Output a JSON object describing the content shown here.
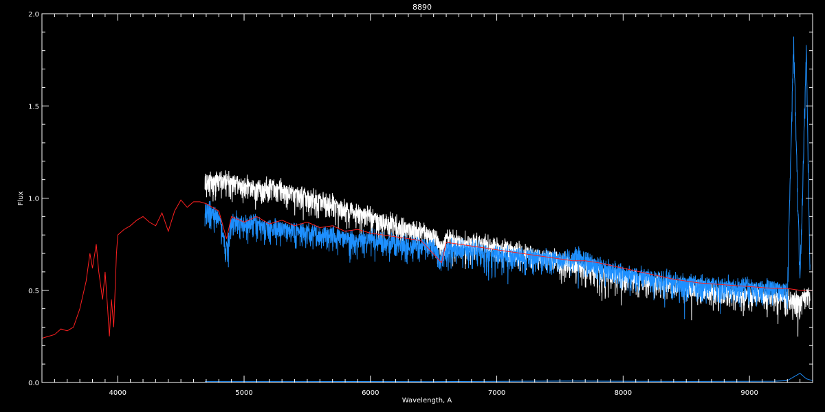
{
  "chart_data": {
    "type": "line",
    "title": "8890",
    "xlabel": "Wavelength, A",
    "ylabel": "Flux",
    "xlim": [
      3400,
      9500
    ],
    "ylim": [
      0.0,
      2.0
    ],
    "x_ticks": [
      4000,
      5000,
      6000,
      7000,
      8000,
      9000
    ],
    "y_ticks": [
      0.0,
      0.5,
      1.0,
      1.5,
      2.0
    ],
    "y_tick_labels": [
      "0.0",
      "0.5",
      "1.0",
      "1.5",
      "2.0"
    ],
    "grid": false,
    "background": "#000000",
    "series": [
      {
        "color": "#ffffff",
        "style": "noisy",
        "x": [
          4690,
          4750,
          4800,
          4900,
          5000,
          5100,
          5200,
          5300,
          5400,
          5500,
          5600,
          5700,
          5800,
          5900,
          6000,
          6100,
          6200,
          6300,
          6400,
          6500,
          6560,
          6600,
          6700,
          6800,
          6900,
          7000,
          7200,
          7400,
          7600,
          7700,
          7800,
          8000,
          8200,
          8400,
          8600,
          8800,
          9000,
          9200,
          9300,
          9400,
          9480
        ],
        "y": [
          1.1,
          1.09,
          1.1,
          1.09,
          1.07,
          1.05,
          1.06,
          1.05,
          1.03,
          1.01,
          0.99,
          0.97,
          0.94,
          0.92,
          0.9,
          0.88,
          0.86,
          0.84,
          0.82,
          0.8,
          0.74,
          0.78,
          0.77,
          0.76,
          0.75,
          0.74,
          0.71,
          0.68,
          0.64,
          0.62,
          0.6,
          0.58,
          0.56,
          0.53,
          0.51,
          0.49,
          0.48,
          0.47,
          0.46,
          0.45,
          0.48
        ]
      },
      {
        "color": "#1e90ff",
        "style": "noisy",
        "x": [
          4690,
          4750,
          4800,
          4860,
          4900,
          5000,
          5100,
          5200,
          5300,
          5400,
          5500,
          5600,
          5700,
          5800,
          5900,
          6000,
          6100,
          6200,
          6300,
          6400,
          6500,
          6563,
          6600,
          6700,
          6800,
          6900,
          7000,
          7200,
          7400,
          7600,
          7620,
          7700,
          7800,
          8000,
          8200,
          8400,
          8600,
          8800,
          9000,
          9200,
          9300,
          9350,
          9400,
          9450,
          9480
        ],
        "y": [
          0.95,
          0.93,
          0.9,
          0.72,
          0.88,
          0.87,
          0.86,
          0.85,
          0.84,
          0.83,
          0.82,
          0.81,
          0.8,
          0.79,
          0.78,
          0.78,
          0.77,
          0.76,
          0.75,
          0.75,
          0.74,
          0.65,
          0.73,
          0.72,
          0.72,
          0.71,
          0.7,
          0.69,
          0.68,
          0.67,
          0.7,
          0.66,
          0.64,
          0.6,
          0.57,
          0.55,
          0.54,
          0.53,
          0.52,
          0.52,
          0.5,
          1.85,
          0.55,
          1.8,
          0.58
        ]
      },
      {
        "color": "#ff2020",
        "style": "line",
        "x": [
          3400,
          3450,
          3500,
          3550,
          3600,
          3650,
          3700,
          3750,
          3780,
          3800,
          3830,
          3850,
          3880,
          3900,
          3920,
          3934,
          3950,
          3968,
          3990,
          4000,
          4050,
          4100,
          4150,
          4200,
          4250,
          4300,
          4350,
          4400,
          4450,
          4500,
          4550,
          4600,
          4650,
          4700,
          4750,
          4800,
          4861,
          4900,
          5000,
          5100,
          5200,
          5300,
          5400,
          5500,
          5600,
          5700,
          5800,
          5900,
          6000,
          6200,
          6400,
          6563,
          6600,
          6800,
          7000,
          7200,
          7400,
          7600,
          7700,
          7800,
          8000,
          8200,
          8400,
          8600,
          8800,
          9000,
          9200,
          9300,
          9400,
          9500
        ],
        "y": [
          0.24,
          0.25,
          0.26,
          0.29,
          0.28,
          0.3,
          0.4,
          0.55,
          0.7,
          0.62,
          0.75,
          0.6,
          0.45,
          0.6,
          0.4,
          0.25,
          0.45,
          0.3,
          0.7,
          0.8,
          0.83,
          0.85,
          0.88,
          0.9,
          0.87,
          0.85,
          0.92,
          0.82,
          0.93,
          0.99,
          0.95,
          0.98,
          0.98,
          0.97,
          0.95,
          0.93,
          0.78,
          0.9,
          0.87,
          0.9,
          0.86,
          0.88,
          0.85,
          0.87,
          0.84,
          0.85,
          0.82,
          0.83,
          0.81,
          0.79,
          0.77,
          0.65,
          0.76,
          0.74,
          0.72,
          0.7,
          0.68,
          0.66,
          0.66,
          0.65,
          0.62,
          0.59,
          0.56,
          0.54,
          0.53,
          0.52,
          0.51,
          0.51,
          0.5,
          0.5
        ]
      },
      {
        "color": "#1e90ff",
        "style": "line",
        "x": [
          4690,
          5500,
          6500,
          7600,
          8500,
          9200,
          9300,
          9400,
          9450,
          9500
        ],
        "y": [
          0.006,
          0.006,
          0.005,
          0.008,
          0.006,
          0.007,
          0.01,
          0.05,
          0.02,
          0.01
        ]
      }
    ]
  }
}
